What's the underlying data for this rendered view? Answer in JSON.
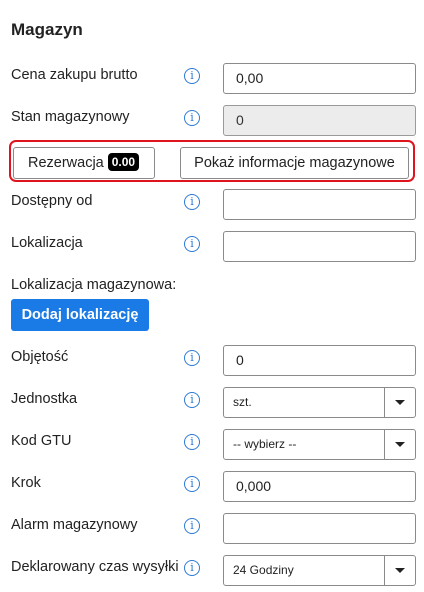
{
  "section": {
    "title": "Magazyn"
  },
  "fields": {
    "purchase_price": {
      "label": "Cena zakupu brutto",
      "value": "0,00"
    },
    "stock": {
      "label": "Stan magazynowy",
      "value": "0"
    },
    "available_from": {
      "label": "Dostępny od",
      "value": ""
    },
    "location": {
      "label": "Lokalizacja",
      "value": ""
    },
    "warehouse_location": {
      "label": "Lokalizacja magazynowa:"
    },
    "volume": {
      "label": "Objętość",
      "value": "0"
    },
    "unit": {
      "label": "Jednostka",
      "value": "szt."
    },
    "gtu_code": {
      "label": "Kod GTU",
      "value": "-- wybierz --"
    },
    "step": {
      "label": "Krok",
      "value": "0,000"
    },
    "stock_alarm": {
      "label": "Alarm magazynowy",
      "value": ""
    },
    "shipping_time": {
      "label": "Deklarowany czas wysyłki",
      "value": "24 Godziny"
    }
  },
  "buttons": {
    "reservation_label": "Rezerwacja",
    "reservation_badge": "0.00",
    "show_stock_info": "Pokaż informacje magazynowe",
    "add_location": "Dodaj lokalizację"
  },
  "icons": {
    "info": "info-icon",
    "dropdown": "chevron-down-icon"
  },
  "colors": {
    "accent": "#1a7ae6",
    "info": "#2d7ad6",
    "highlight": "#e0141e"
  }
}
